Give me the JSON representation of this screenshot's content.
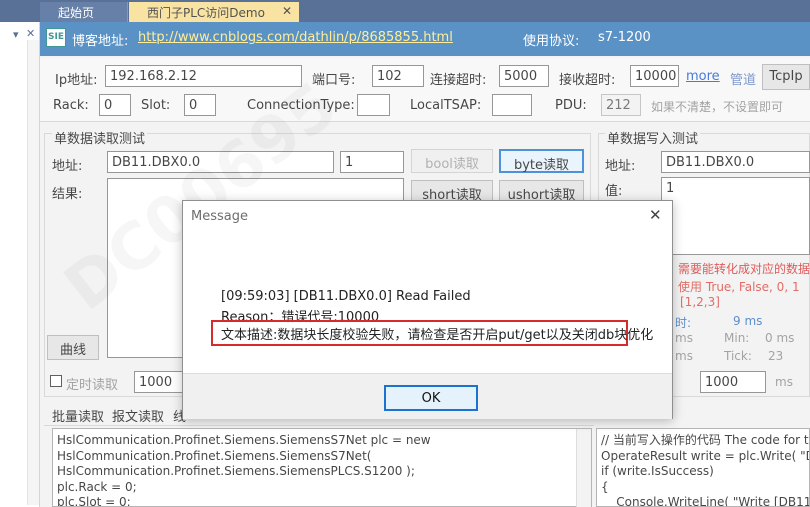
{
  "tabs": [
    {
      "label": "起始页",
      "active": false
    },
    {
      "label": "西门子PLC访问Demo",
      "active": true
    }
  ],
  "header": {
    "blog_label": "博客地址:",
    "blog_url": "http://www.cnblogs.com/dathlin/p/8685855.html",
    "protocol_label": "使用协议:",
    "protocol_value": "s7-1200",
    "logo_text": "SIE"
  },
  "connection": {
    "ip_label": "Ip地址:",
    "ip_value": "192.168.2.12",
    "port_label": "端口号:",
    "port_value": "102",
    "connect_timeout_label": "连接超时:",
    "connect_timeout_value": "5000",
    "receive_timeout_label": "接收超时:",
    "receive_timeout_value": "10000",
    "more_link": "more",
    "pipe_link": "管道",
    "tcpip_button": "TcpIp",
    "rack_label": "Rack:",
    "rack_value": "0",
    "slot_label": "Slot:",
    "slot_value": "0",
    "connection_type_label": "ConnectionType:",
    "connection_type_value": "",
    "local_tsap_label": "LocalTSAP:",
    "local_tsap_value": "",
    "pdu_label": "PDU:",
    "pdu_value": "212",
    "hint": "如果不清楚，不设置即可"
  },
  "read_panel": {
    "title": "单数据读取测试",
    "address_label": "地址:",
    "address_value": "DB11.DBX0.0",
    "length_value": "1",
    "bool_read_button": "bool读取",
    "byte_read_button": "byte读取",
    "short_read_button": "short读取",
    "ushort_read_button": "ushort读取",
    "result_label": "结果:",
    "curve_button": "曲线",
    "timed_read_label": "定时读取",
    "timed_read_value": "1000"
  },
  "write_panel": {
    "title": "单数据写入测试",
    "address_label": "地址:",
    "address_value": "DB11.DBX0.0",
    "value_label": "值:",
    "value_value": "1",
    "note_text": "需要能转化成对应的数据",
    "use_text": "使用 True, False, 0, 1",
    "array_text": "[1,2,3]",
    "time_label": "时:",
    "time_value": "9 ms",
    "min_label": "Min:",
    "min_value": "0 ms",
    "ms_text": "ms",
    "tick_label": "Tick:",
    "tick_value": "23",
    "ms2_text": "ms",
    "interval_value": "1000",
    "interval_unit": "ms"
  },
  "bottom_tabs": [
    "批量读取",
    "报文读取",
    "线"
  ],
  "code_left": "HslCommunication.Profinet.Siemens.SiemensS7Net plc = new\nHslCommunication.Profinet.Siemens.SiemensS7Net(\nHslCommunication.Profinet.Siemens.SiemensPLCS.S1200 );\nplc.Rack = 0;\nplc.Slot = 0;",
  "code_right": "// 当前写入操作的代码 The code for t\nOperateResult write = plc.Write( \"DE\nif (write.IsSuccess)\n{\n    Console.WriteLine( \"Write [DB11",
  "dialog": {
    "title": "Message",
    "line1": "[09:59:03] [DB11.DBX0.0] Read Failed",
    "line2": "Reason：错误代号:10000",
    "line3": "文本描述:数据块长度校验失败，请检查是否开启put/get以及关闭db块优化",
    "ok_button": "OK",
    "highlight_color": "#d62b2b"
  },
  "watermark_text": "DC00695"
}
